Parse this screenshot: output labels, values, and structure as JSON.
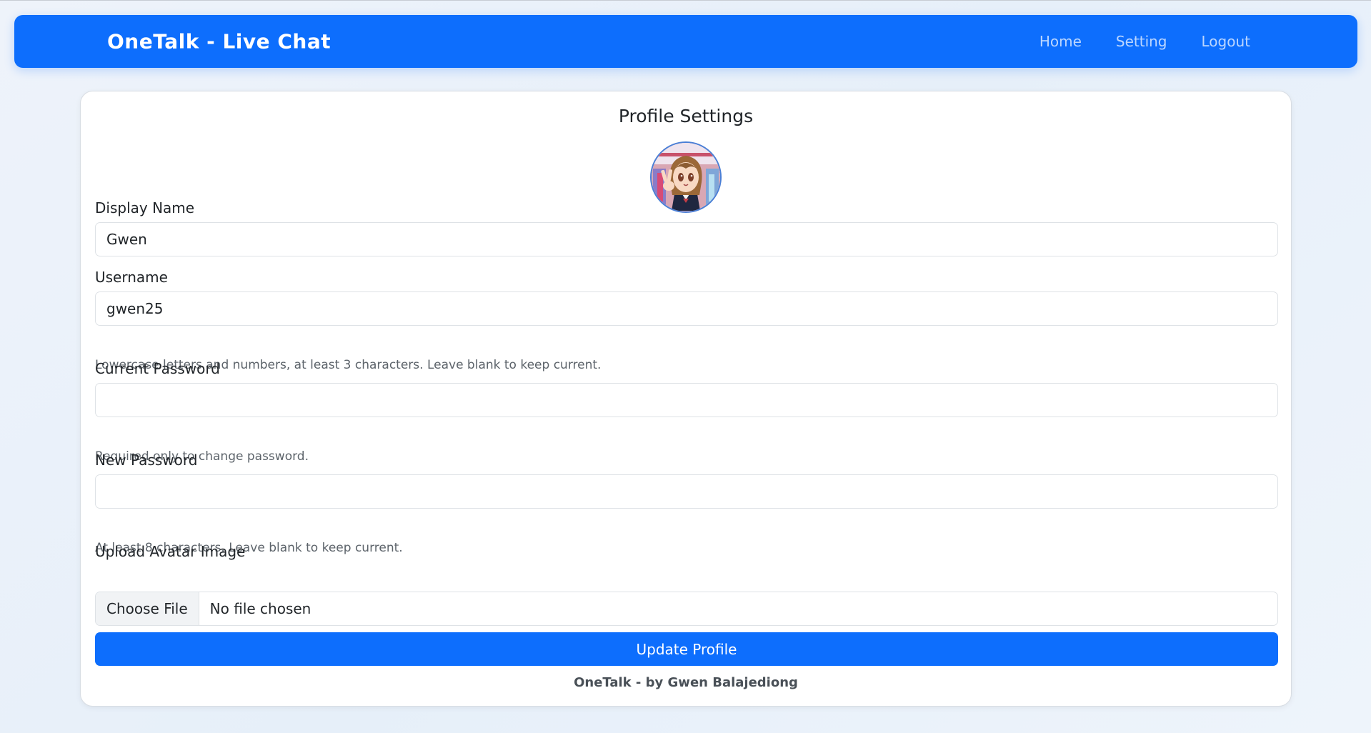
{
  "navbar": {
    "brand": "OneTalk - Live Chat",
    "links": [
      "Home",
      "Setting",
      "Logout"
    ],
    "color": "#0d6efd"
  },
  "profile": {
    "title": "Profile Settings",
    "avatar_icon": "anime-girl-avatar",
    "fields": {
      "display_name": {
        "label": "Display Name",
        "value": "Gwen"
      },
      "username": {
        "label": "Username",
        "value": "gwen25",
        "help": "Lowercase letters and numbers, at least 3 characters. Leave blank to keep current."
      },
      "current_password": {
        "label": "Current Password",
        "value": "",
        "help": "Required only to change password."
      },
      "new_password": {
        "label": "New Password",
        "value": "",
        "help": "At least 8 characters. Leave blank to keep current."
      },
      "avatar_upload": {
        "label": "Upload Avatar Image",
        "button": "Choose File",
        "status": "No file chosen"
      }
    },
    "submit_label": "Update Profile",
    "footer": "OneTalk - by Gwen Balajediong"
  }
}
